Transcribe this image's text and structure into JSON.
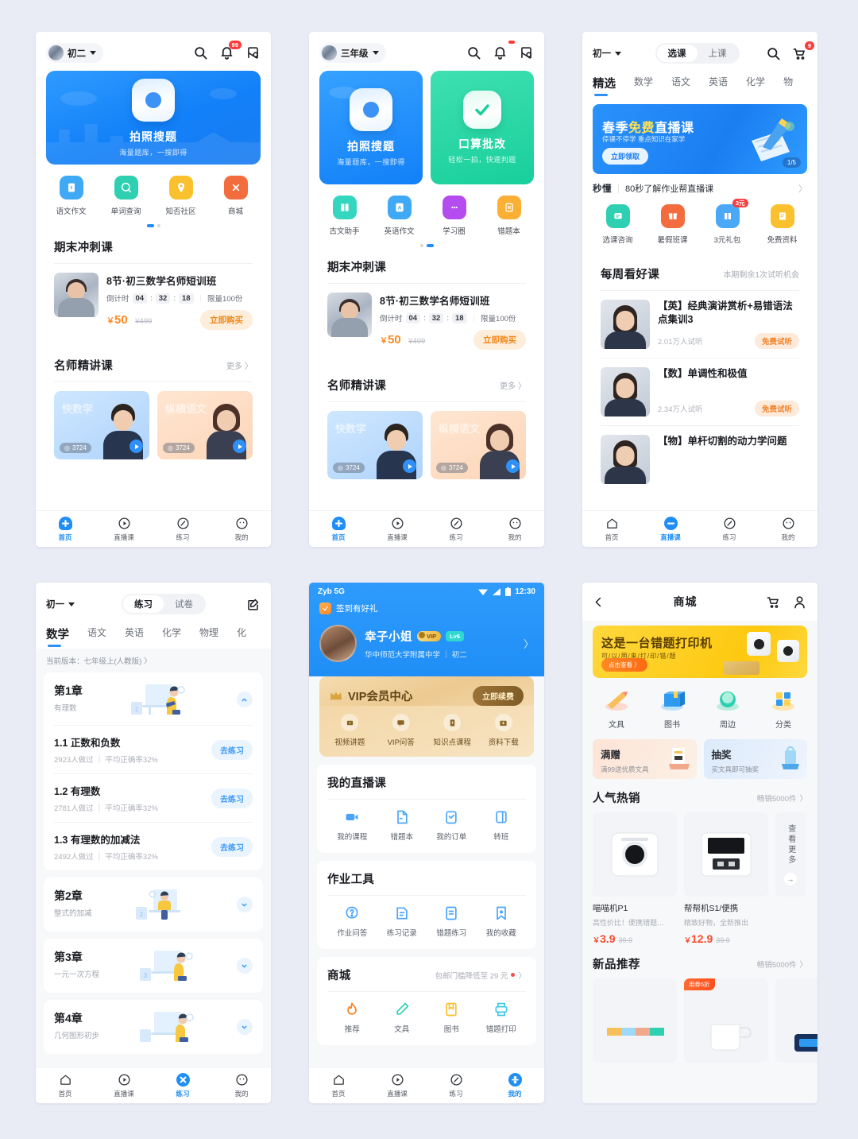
{
  "screen1": {
    "grade": "初二",
    "notification_badge": "99",
    "hero": {
      "title": "拍照搜题",
      "subtitle": "海量题库，一搜即得"
    },
    "quick": [
      {
        "label": "语文作文",
        "icon": "book-icon",
        "color": "#3fa9f5"
      },
      {
        "label": "单词查询",
        "icon": "english-search-icon",
        "color": "#2fd0b2"
      },
      {
        "label": "知否社区",
        "icon": "location-icon",
        "color": "#fbc02d"
      },
      {
        "label": "商城",
        "icon": "shop-icon",
        "color": "#f36c3d"
      }
    ],
    "promo_card": {
      "title": "期末冲刺课",
      "course": "8节·初三数学名师短训班",
      "countdown_label": "倒计时",
      "hh": "04",
      "mm": "32",
      "ss": "18",
      "limit": "限量100份",
      "price": "50",
      "old_price": "¥499",
      "buy": "立即购买"
    },
    "teacher_card": {
      "title": "名师精讲课",
      "more": "更多",
      "items": [
        {
          "watermark": "快数学",
          "views": "3724"
        },
        {
          "watermark": "纵横语文",
          "views": "3724"
        }
      ]
    },
    "tabs": [
      {
        "label": "首页",
        "icon": "home-icon",
        "active": true
      },
      {
        "label": "直播课",
        "icon": "play-icon",
        "active": false
      },
      {
        "label": "练习",
        "icon": "pencil-icon",
        "active": false
      },
      {
        "label": "我的",
        "icon": "face-icon",
        "active": false
      }
    ]
  },
  "screen2": {
    "grade": "三年级",
    "notification_badge": "",
    "heroes": [
      {
        "title": "拍照搜题",
        "subtitle": "海量题库，一搜即得",
        "icon": "camera-icon"
      },
      {
        "title": "口算批改",
        "subtitle": "轻松一拍，快速判题",
        "icon": "check-icon"
      }
    ],
    "quick": [
      {
        "label": "古文助手",
        "icon": "classic-book-icon",
        "color": "#35d6c0"
      },
      {
        "label": "英语作文",
        "icon": "letter-a-icon",
        "color": "#3fa9f5"
      },
      {
        "label": "学习圈",
        "icon": "chat-icon",
        "color": "#b44cf0"
      },
      {
        "label": "错题本",
        "icon": "wrong-book-icon",
        "color": "#fbb034"
      }
    ],
    "promo_card": {
      "title": "期末冲刺课",
      "course": "8节·初三数学名师短训班",
      "countdown_label": "倒计时",
      "hh": "04",
      "mm": "32",
      "ss": "18",
      "limit": "限量100份",
      "price": "50",
      "old_price": "¥499",
      "buy": "立即购买"
    },
    "teacher_card": {
      "title": "名师精讲课",
      "more": "更多",
      "items": [
        {
          "watermark": "快数学",
          "views": "3724"
        },
        {
          "watermark": "纵横语文",
          "views": "3724"
        }
      ]
    },
    "tabs": [
      {
        "label": "首页",
        "active": true
      },
      {
        "label": "直播课",
        "active": false
      },
      {
        "label": "练习",
        "active": false
      },
      {
        "label": "我的",
        "active": false
      }
    ]
  },
  "screen3": {
    "grade": "初一",
    "seg": [
      {
        "label": "选课",
        "on": true
      },
      {
        "label": "上课",
        "on": false
      }
    ],
    "cart_badge": "9",
    "subject_tabs": [
      {
        "label": "精选",
        "on": true
      },
      {
        "label": "数学",
        "on": false
      },
      {
        "label": "语文",
        "on": false
      },
      {
        "label": "英语",
        "on": false
      },
      {
        "label": "化学",
        "on": false
      },
      {
        "label": "物",
        "on": false
      }
    ],
    "banner": {
      "title_a": "春季",
      "title_b": "免费",
      "title_c": "直播课",
      "subtitle": "停课不停学 重点知识在家学",
      "cta": "立即领取",
      "page": "1/5"
    },
    "notice": {
      "logo": "秒懂",
      "text": "80秒了解作业帮直播课"
    },
    "quick": [
      {
        "label": "选课咨询",
        "icon": "consult-icon",
        "color": "#2fd0b2",
        "badge": ""
      },
      {
        "label": "暑假班课",
        "icon": "gift-icon",
        "color": "#f36c3d",
        "badge": ""
      },
      {
        "label": "3元礼包",
        "icon": "package-icon",
        "color": "#4aa8f7",
        "badge": "3元"
      },
      {
        "label": "免费资料",
        "icon": "doc-icon",
        "color": "#fbc02d",
        "badge": ""
      }
    ],
    "weekly": {
      "title": "每周看好课",
      "note": "本期剩余1次试听机会",
      "items": [
        {
          "title": "【英】经典演讲赏析+易错语法点集训3",
          "count": "2.01万人试听",
          "tag": "免费试听"
        },
        {
          "title": "【数】单调性和极值",
          "count": "2.34万人试听",
          "tag": "免费试听"
        },
        {
          "title": "【物】单杆切割的动力学问题",
          "count": "",
          "tag": ""
        }
      ]
    },
    "tabs": [
      {
        "label": "首页",
        "active": false
      },
      {
        "label": "直播课",
        "active": true
      },
      {
        "label": "练习",
        "active": false
      },
      {
        "label": "我的",
        "active": false
      }
    ]
  },
  "screen4": {
    "grade": "初一",
    "seg": [
      {
        "label": "练习",
        "on": true
      },
      {
        "label": "试卷",
        "on": false
      }
    ],
    "subject_tabs": [
      {
        "label": "数学",
        "on": true
      },
      {
        "label": "语文",
        "on": false
      },
      {
        "label": "英语",
        "on": false
      },
      {
        "label": "化学",
        "on": false
      },
      {
        "label": "物理",
        "on": false
      },
      {
        "label": "化",
        "on": false
      }
    ],
    "version": "当前版本：七年级上(人教版) 〉",
    "chapters": [
      {
        "title": "第1章",
        "subtitle": "有理数",
        "expanded": true,
        "num": "1",
        "sections": [
          {
            "title": "1.1 正数和负数",
            "meta": "2923人做过 ｜ 平均正确率32%",
            "btn": "去练习"
          },
          {
            "title": "1.2 有理数",
            "meta": "2781人做过 ｜ 平均正确率32%",
            "btn": "去练习"
          },
          {
            "title": "1.3 有理数的加减法",
            "meta": "2492人做过 ｜ 平均正确率32%",
            "btn": "去练习"
          }
        ]
      },
      {
        "title": "第2章",
        "subtitle": "整式的加减",
        "expanded": false,
        "num": "2",
        "sections": []
      },
      {
        "title": "第3章",
        "subtitle": "一元一次方程",
        "expanded": false,
        "num": "3",
        "sections": []
      },
      {
        "title": "第4章",
        "subtitle": "几何图形初步",
        "expanded": false,
        "num": "4",
        "sections": []
      }
    ],
    "tabs": [
      {
        "label": "首页",
        "active": false
      },
      {
        "label": "直播课",
        "active": false
      },
      {
        "label": "练习",
        "active": true
      },
      {
        "label": "我的",
        "active": false
      }
    ]
  },
  "screen5": {
    "status": {
      "carrier": "Zyb 5G",
      "time": "12:30"
    },
    "signin": "签到有好礼",
    "user": {
      "name": "幸子小姐",
      "vip_tag": "VIP",
      "level": "Lv6",
      "school": "华中师范大学附属中学 ｜ 初二"
    },
    "vip": {
      "title": "VIP会员中心",
      "renew": "立即续费",
      "items": [
        {
          "label": "视频讲题",
          "icon": "video-icon"
        },
        {
          "label": "VIP问答",
          "icon": "qa-icon"
        },
        {
          "label": "知识点课程",
          "icon": "knowledge-icon"
        },
        {
          "label": "资料下载",
          "icon": "download-icon"
        }
      ]
    },
    "live": {
      "title": "我的直播课",
      "items": [
        {
          "label": "我的课程",
          "icon": "course-icon"
        },
        {
          "label": "错题本",
          "icon": "wrongbook-icon"
        },
        {
          "label": "我的订单",
          "icon": "order-icon"
        },
        {
          "label": "转班",
          "icon": "transfer-icon"
        }
      ]
    },
    "tools": {
      "title": "作业工具",
      "items": [
        {
          "label": "作业问答",
          "icon": "question-icon"
        },
        {
          "label": "练习记录",
          "icon": "record-icon"
        },
        {
          "label": "错题练习",
          "icon": "wrongpractice-icon"
        },
        {
          "label": "我的收藏",
          "icon": "bookmark-icon"
        }
      ]
    },
    "mall": {
      "title": "商城",
      "note": "包邮门槛降低至 29 元",
      "items": [
        {
          "label": "推荐",
          "icon": "fire-icon",
          "color": "#f8821f"
        },
        {
          "label": "文具",
          "icon": "pen-icon",
          "color": "#2fd0b2"
        },
        {
          "label": "图书",
          "icon": "book2-icon",
          "color": "#fbc02d"
        },
        {
          "label": "错题打印",
          "icon": "printer-icon",
          "color": "#3fc8e8"
        }
      ]
    },
    "tabs": [
      {
        "label": "首页",
        "active": false
      },
      {
        "label": "直播课",
        "active": false
      },
      {
        "label": "练习",
        "active": false
      },
      {
        "label": "我的",
        "active": true
      }
    ]
  },
  "screen6": {
    "title": "商城",
    "banner": {
      "title": "这是一台错题打印机",
      "subtitle": "可/以/用/来/打/印/错/题",
      "cta": "点击查看 〉"
    },
    "categories": [
      {
        "label": "文具",
        "icon": "stationery-icon"
      },
      {
        "label": "图书",
        "icon": "books-icon"
      },
      {
        "label": "周边",
        "icon": "goods-icon"
      },
      {
        "label": "分类",
        "icon": "grid-icon"
      }
    ],
    "promos": [
      {
        "title": "满赠",
        "desc": "满99送优质文具"
      },
      {
        "title": "抽奖",
        "desc": "买文具即可抽奖"
      }
    ],
    "hot": {
      "title": "人气热销",
      "note": "畅销5000件",
      "products": [
        {
          "name": "喵喵机P1",
          "desc": "高性价比！便携错题…",
          "price": "3.9",
          "old": "39.9"
        },
        {
          "name": "帮帮机S1/便携",
          "desc": "精致好物，全新推出",
          "price": "12.9",
          "old": "39.9"
        }
      ],
      "more": "查看更多"
    },
    "new": {
      "title": "新品推荐",
      "note": "畅销5000件",
      "tag": "用券5折"
    }
  }
}
